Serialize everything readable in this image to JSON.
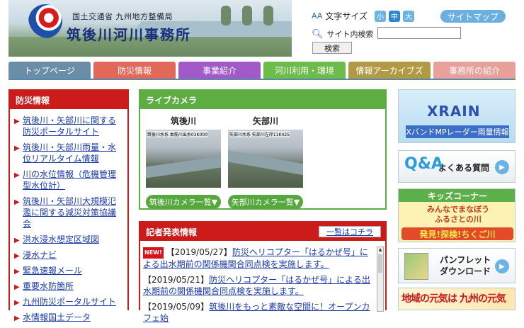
{
  "header": {
    "ministry": "国土交通省 九州地方整備局",
    "office": "筑後川河川事務所",
    "fontsize_label": "文字サイズ",
    "fontsize_aa": "AA",
    "sizes": [
      "小",
      "中",
      "大"
    ],
    "sitemap": "サイトマップ",
    "search_label": "サイト内検索",
    "search_value": "",
    "search_button": "検索"
  },
  "nav": {
    "tabs": [
      {
        "label": "トップページ",
        "color": "#6b8ea8"
      },
      {
        "label": "防災情報",
        "color": "#e2685a"
      },
      {
        "label": "事業紹介",
        "color": "#a25ac9"
      },
      {
        "label": "河川利用・環境",
        "color": "#6cbc4a"
      },
      {
        "label": "情報アーカイブズ",
        "color": "#b29a45"
      },
      {
        "label": "事務所の紹介",
        "color": "#e8a09a"
      }
    ]
  },
  "sidebar": {
    "title": "防災情報",
    "items": [
      "筑後川・矢部川に関する防災ポータルサイト",
      "筑後川・矢部川雨量・水位リアルタイム情報",
      "川の水位情報（危機管理型水位計）",
      "筑後川・矢部川大規模氾濫に関する減災対策協議会",
      "洪水浸水想定区域図",
      "浸水ナビ",
      "緊急速報メール",
      "重要水防箇所",
      "九州防災ポータルサイト",
      "水情報国土データ"
    ]
  },
  "camera": {
    "title": "ライブカメラ",
    "cams": [
      {
        "name": "筑後川",
        "caption": "筑後川水系 本筋川出水03K000",
        "button": "筑後川カメラ一覧▼"
      },
      {
        "name": "矢部川",
        "caption": "矢部川水系 矢部川左岸11K425",
        "button": "矢部川カメラ一覧▼"
      }
    ]
  },
  "press": {
    "title": "記者発表情報",
    "more": "一覧はコチラ",
    "new_badge": "NEW!",
    "items": [
      {
        "date": "【2019/05/27】",
        "text": "防災ヘリコプター「はるかぜ号」による出水期前の関係機関合同点検を実施します。"
      },
      {
        "date": "【2019/05/21】",
        "text": "防災ヘリコプター「はるかぜ号」による出水期前の関係機関合同点検を実施します。"
      },
      {
        "date": "【2019/05/09】",
        "text": "筑後川をもっと素敵な空間に！オープンカフェ始"
      }
    ]
  },
  "right": {
    "xrain_title": "XRAIN",
    "xrain_sub": "XバンドMPレーダー雨量情報",
    "faq_icon": "Q&A",
    "faq": "よくある質問",
    "kids_title": "キッズコーナー",
    "kids_line1": "みんなでまなぼう",
    "kids_line2": "ふるさとの川",
    "kids_banner": "発見!探検!ちくご川",
    "pamph_line1": "パンフレット",
    "pamph_line2": "ダウンロード",
    "genki": "地域の元気は 九州の元気"
  }
}
